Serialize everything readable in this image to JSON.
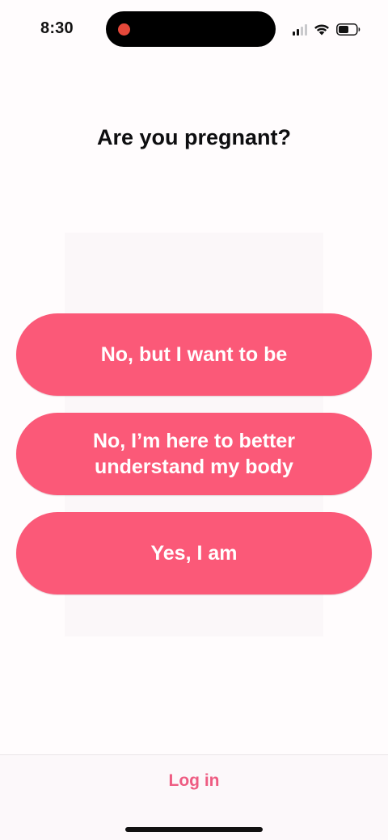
{
  "status_bar": {
    "time": "8:30",
    "record_color": "#E5483A",
    "icons": [
      "signal-icon",
      "wifi-icon",
      "battery-icon"
    ]
  },
  "question": {
    "title": "Are you pregnant?"
  },
  "options": [
    {
      "label": "No, but I want to be"
    },
    {
      "label": "No, I’m here to better\nunderstand my body"
    },
    {
      "label": "Yes, I am"
    }
  ],
  "footer": {
    "login_label": "Log in"
  },
  "colors": {
    "accent": "#FB5978",
    "link": "#EE5C82",
    "background": "#FFFCFD",
    "text": "#0E0E10"
  }
}
